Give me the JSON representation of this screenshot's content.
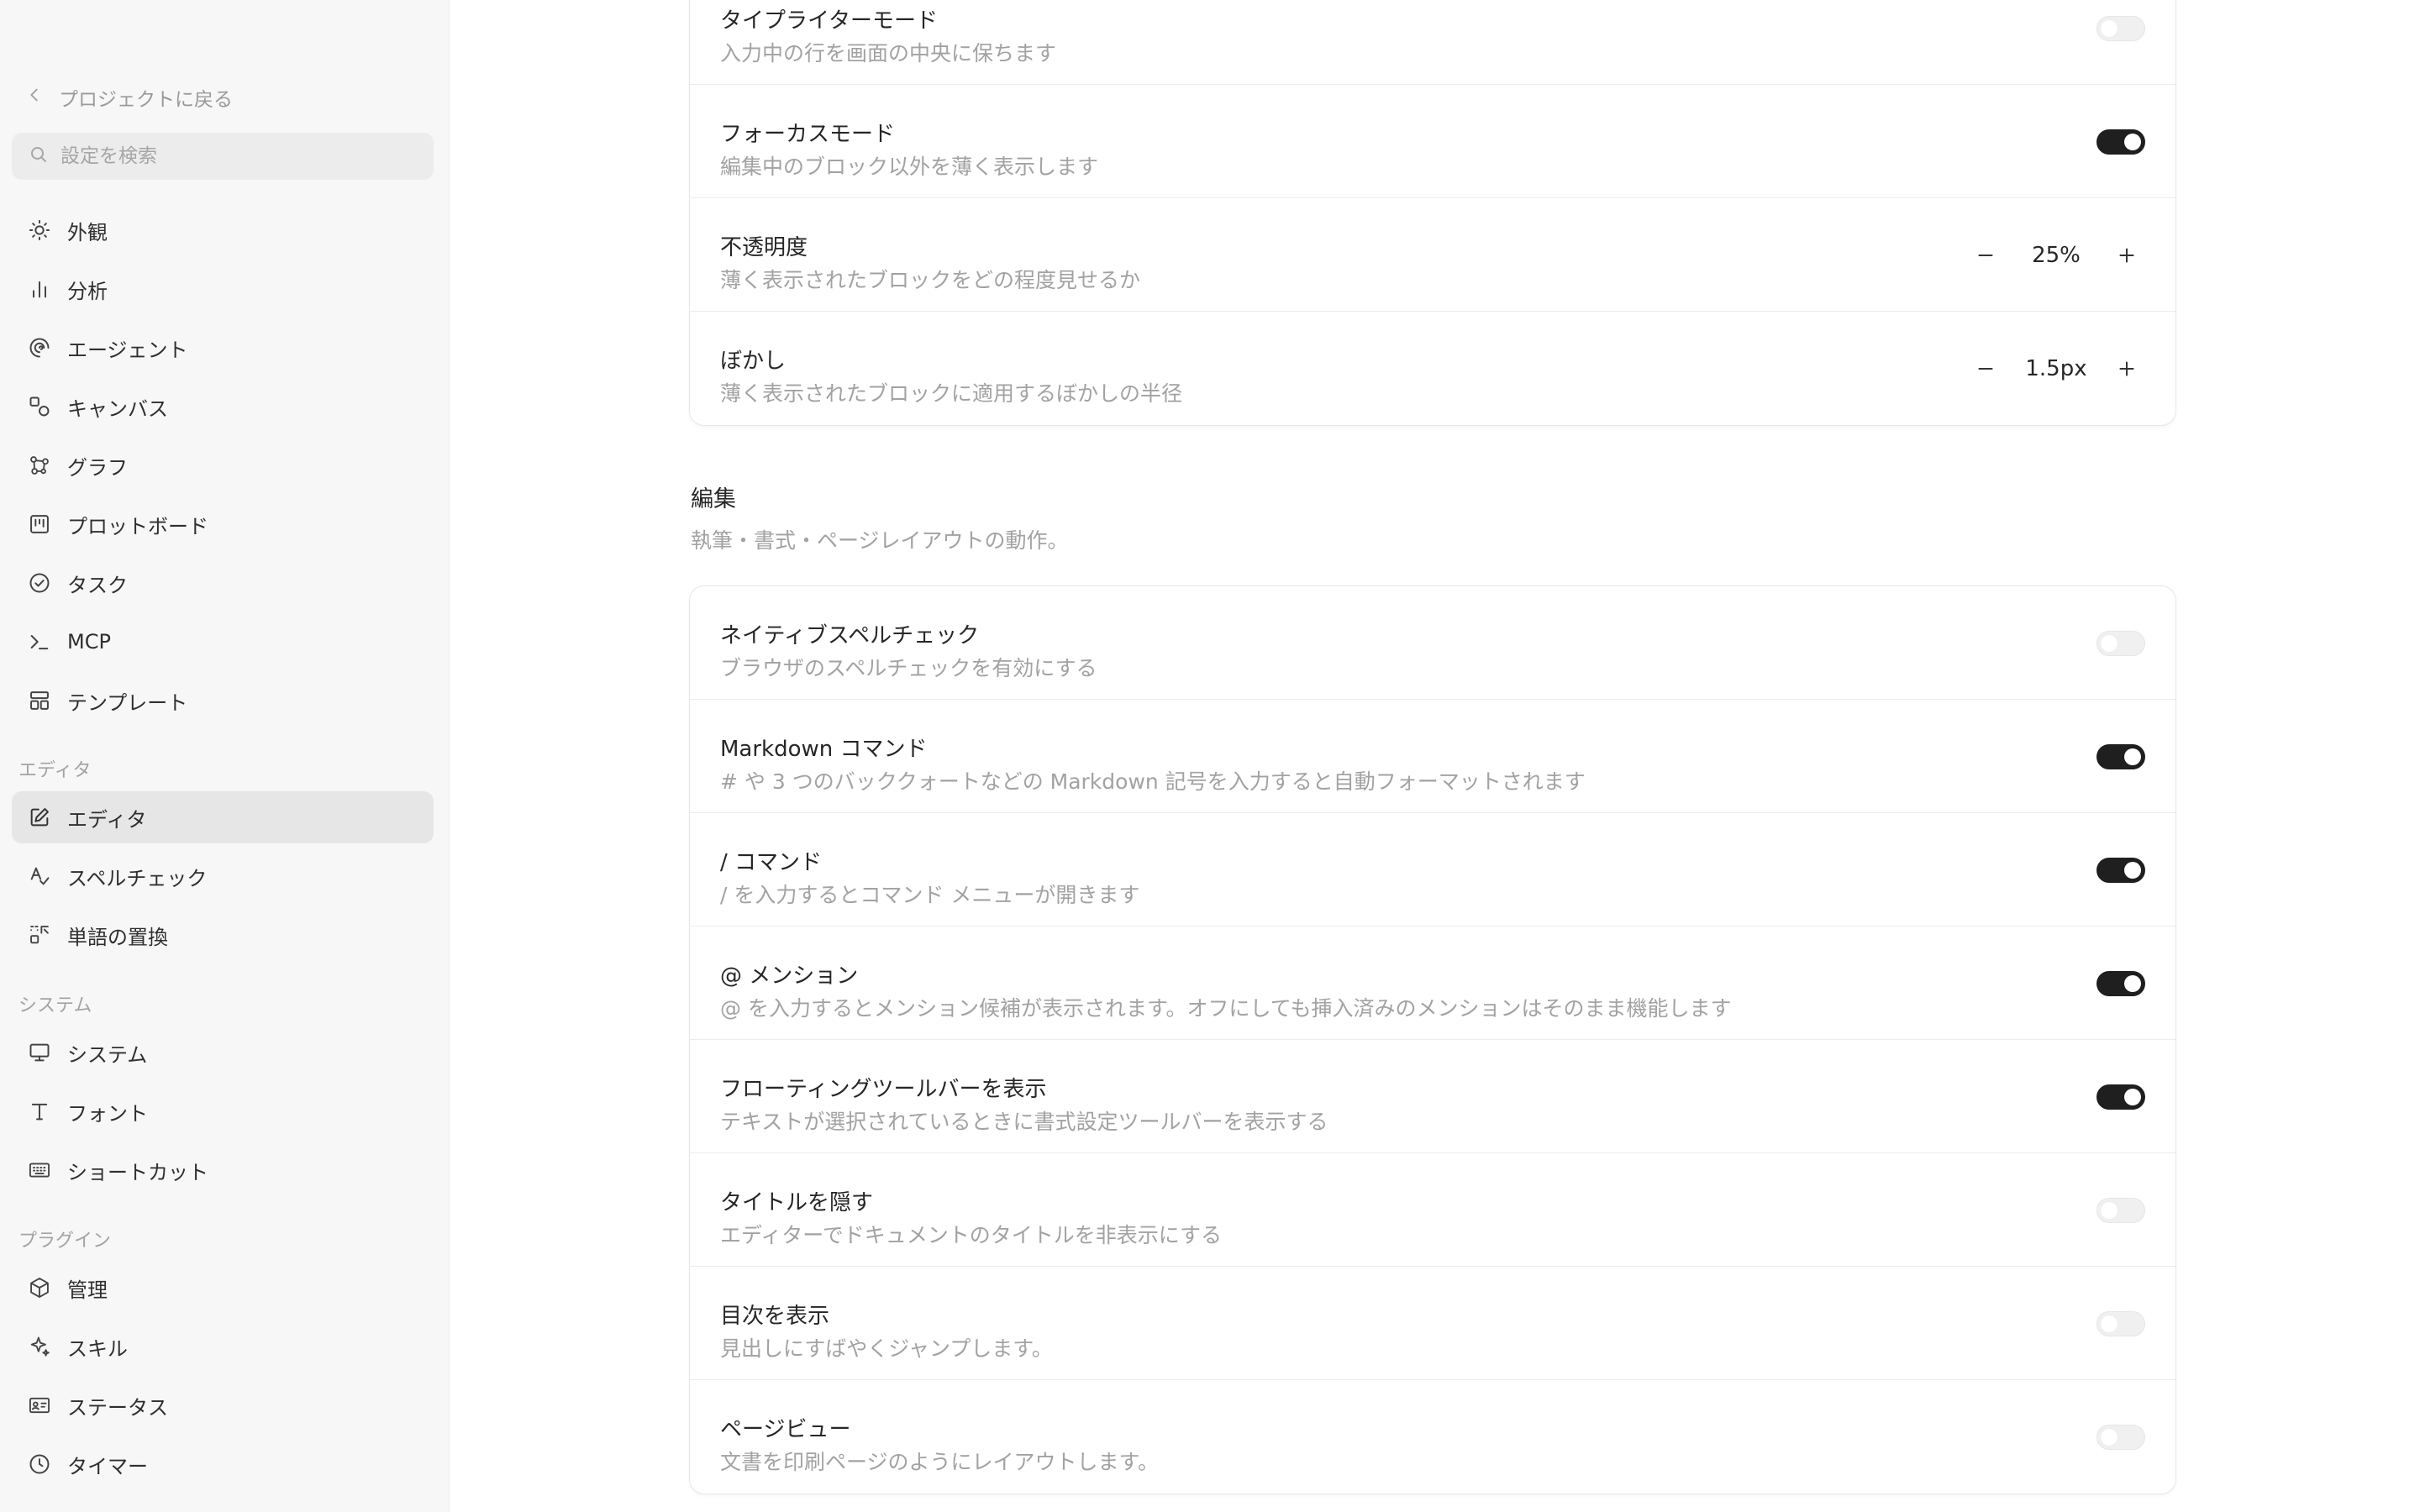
{
  "sidebar": {
    "back_label": "プロジェクトに戻る",
    "search_placeholder": "設定を検索",
    "items_top": [
      {
        "label": "外観",
        "icon": "sun-icon"
      },
      {
        "label": "分析",
        "icon": "bar-chart-icon"
      },
      {
        "label": "エージェント",
        "icon": "spiral-icon"
      },
      {
        "label": "キャンバス",
        "icon": "shapes-icon"
      },
      {
        "label": "グラフ",
        "icon": "graph-icon"
      },
      {
        "label": "プロットボード",
        "icon": "board-icon"
      },
      {
        "label": "タスク",
        "icon": "check-circle-icon"
      },
      {
        "label": "MCP",
        "icon": "terminal-icon"
      },
      {
        "label": "テンプレート",
        "icon": "template-icon"
      }
    ],
    "section_editor": "エディタ",
    "items_editor": [
      {
        "label": "エディタ",
        "icon": "edit-icon",
        "active": true
      },
      {
        "label": "スペルチェック",
        "icon": "spellcheck-icon"
      },
      {
        "label": "単語の置換",
        "icon": "replace-icon"
      }
    ],
    "section_system": "システム",
    "items_system": [
      {
        "label": "システム",
        "icon": "monitor-icon"
      },
      {
        "label": "フォント",
        "icon": "type-icon"
      },
      {
        "label": "ショートカット",
        "icon": "keyboard-icon"
      }
    ],
    "section_plugins": "プラグイン",
    "items_plugins": [
      {
        "label": "管理",
        "icon": "package-icon"
      },
      {
        "label": "スキル",
        "icon": "sparkle-icon"
      },
      {
        "label": "ステータス",
        "icon": "id-card-icon"
      },
      {
        "label": "タイマー",
        "icon": "clock-icon"
      }
    ]
  },
  "focus_card": {
    "rows": [
      {
        "title": "タイプライターモード",
        "desc": "入力中の行を画面の中央に保ちます",
        "toggle": false
      },
      {
        "title": "フォーカスモード",
        "desc": "編集中のブロック以外を薄く表示します",
        "toggle": true
      },
      {
        "title": "不透明度",
        "desc": "薄く表示されたブロックをどの程度見せるか",
        "stepper": "25%"
      },
      {
        "title": "ぼかし",
        "desc": "薄く表示されたブロックに適用するぼかしの半径",
        "stepper": "1.5px"
      }
    ]
  },
  "editing": {
    "title": "編集",
    "desc": "執筆・書式・ページレイアウトの動作。",
    "rows": [
      {
        "title": "ネイティブスペルチェック",
        "desc": "ブラウザのスペルチェックを有効にする",
        "toggle": false
      },
      {
        "title": "Markdown コマンド",
        "desc": "# や 3 つのバッククォートなどの Markdown 記号を入力すると自動フォーマットされます",
        "toggle": true
      },
      {
        "title": "/ コマンド",
        "desc": "/ を入力するとコマンド メニューが開きます",
        "toggle": true
      },
      {
        "title": "@ メンション",
        "desc": "@ を入力するとメンション候補が表示されます。オフにしても挿入済みのメンションはそのまま機能します",
        "toggle": true
      },
      {
        "title": "フローティングツールバーを表示",
        "desc": "テキストが選択されているときに書式設定ツールバーを表示する",
        "toggle": true
      },
      {
        "title": "タイトルを隠す",
        "desc": "エディターでドキュメントのタイトルを非表示にする",
        "toggle": false
      },
      {
        "title": "目次を表示",
        "desc": "見出しにすばやくジャンプします。",
        "toggle": false
      },
      {
        "title": "ページビュー",
        "desc": "文書を印刷ページのようにレイアウトします。",
        "toggle": false
      }
    ]
  }
}
